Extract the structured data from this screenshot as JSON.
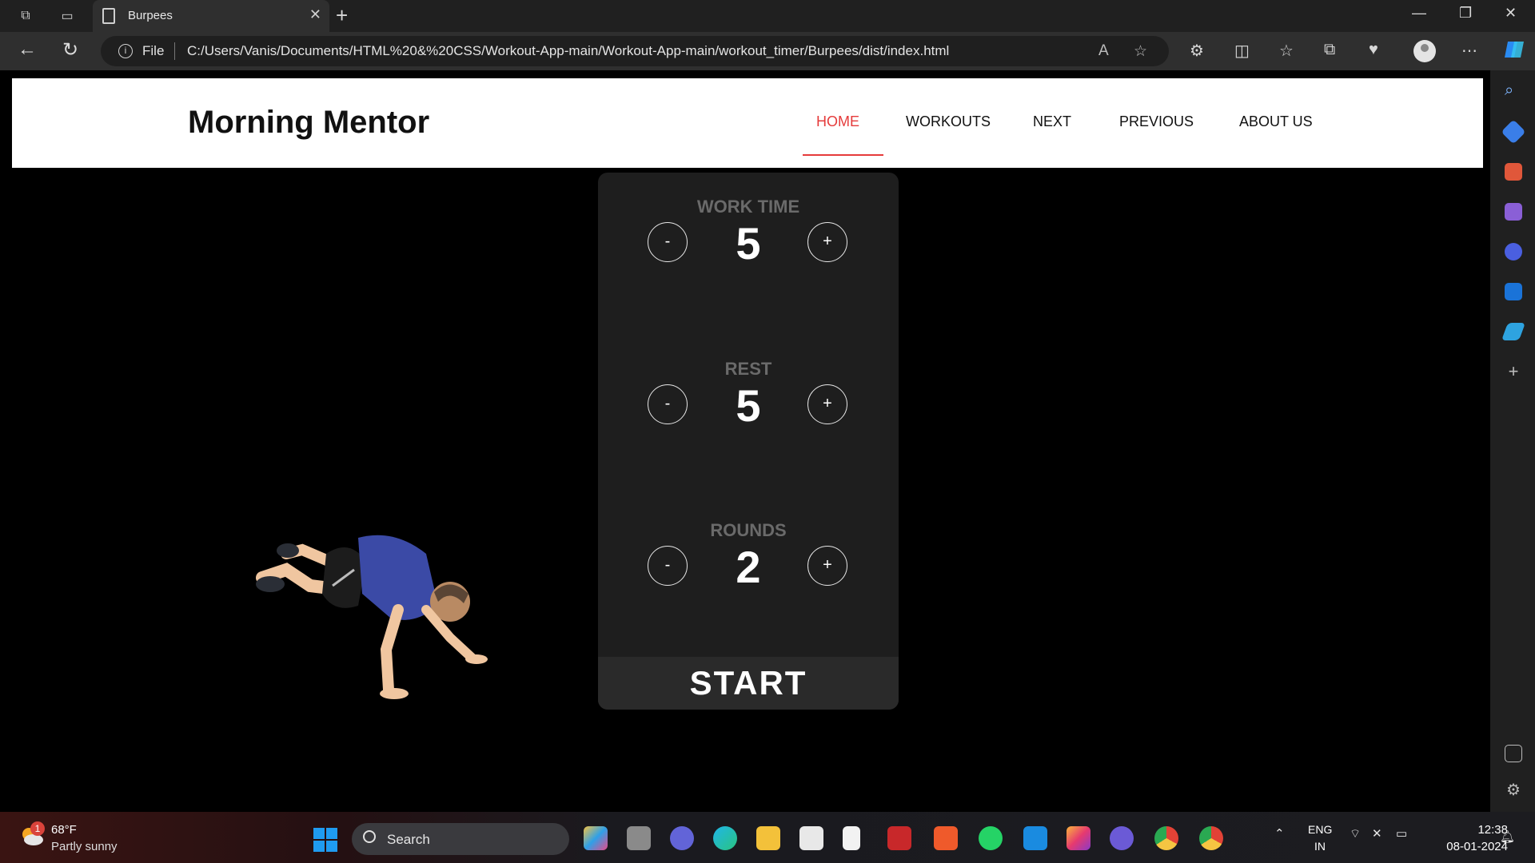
{
  "browser": {
    "tab_title": "Burpees",
    "close_glyph": "✕",
    "newtab_glyph": "+",
    "file_label": "File",
    "url": "C:/Users/Vanis/Documents/HTML%20&%20CSS/Workout-App-main/Workout-App-main/workout_timer/Burpees/dist/index.html"
  },
  "site": {
    "brand": "Morning Mentor",
    "nav": [
      {
        "label": "HOME",
        "active": true
      },
      {
        "label": "WORKOUTS"
      },
      {
        "label": "NEXT"
      },
      {
        "label": "PREVIOUS"
      },
      {
        "label": "ABOUT US"
      }
    ]
  },
  "timer": {
    "work": {
      "label": "WORK TIME",
      "value": "5"
    },
    "rest": {
      "label": "REST",
      "value": "5"
    },
    "rounds": {
      "label": "ROUNDS",
      "value": "2"
    },
    "minus": "-",
    "plus": "+",
    "start_label": "START"
  },
  "taskbar": {
    "weather_badge": "1",
    "weather_temp": "68°F",
    "weather_desc": "Partly sunny",
    "search_placeholder": "Search",
    "lang_line1": "ENG",
    "lang_line2": "IN",
    "time": "12:38",
    "date": "08-01-2024"
  },
  "colors": {
    "accent_nav": "#e53b3b",
    "card_bg": "#1e1e1e",
    "edge_blue": "#1f9bf0"
  }
}
